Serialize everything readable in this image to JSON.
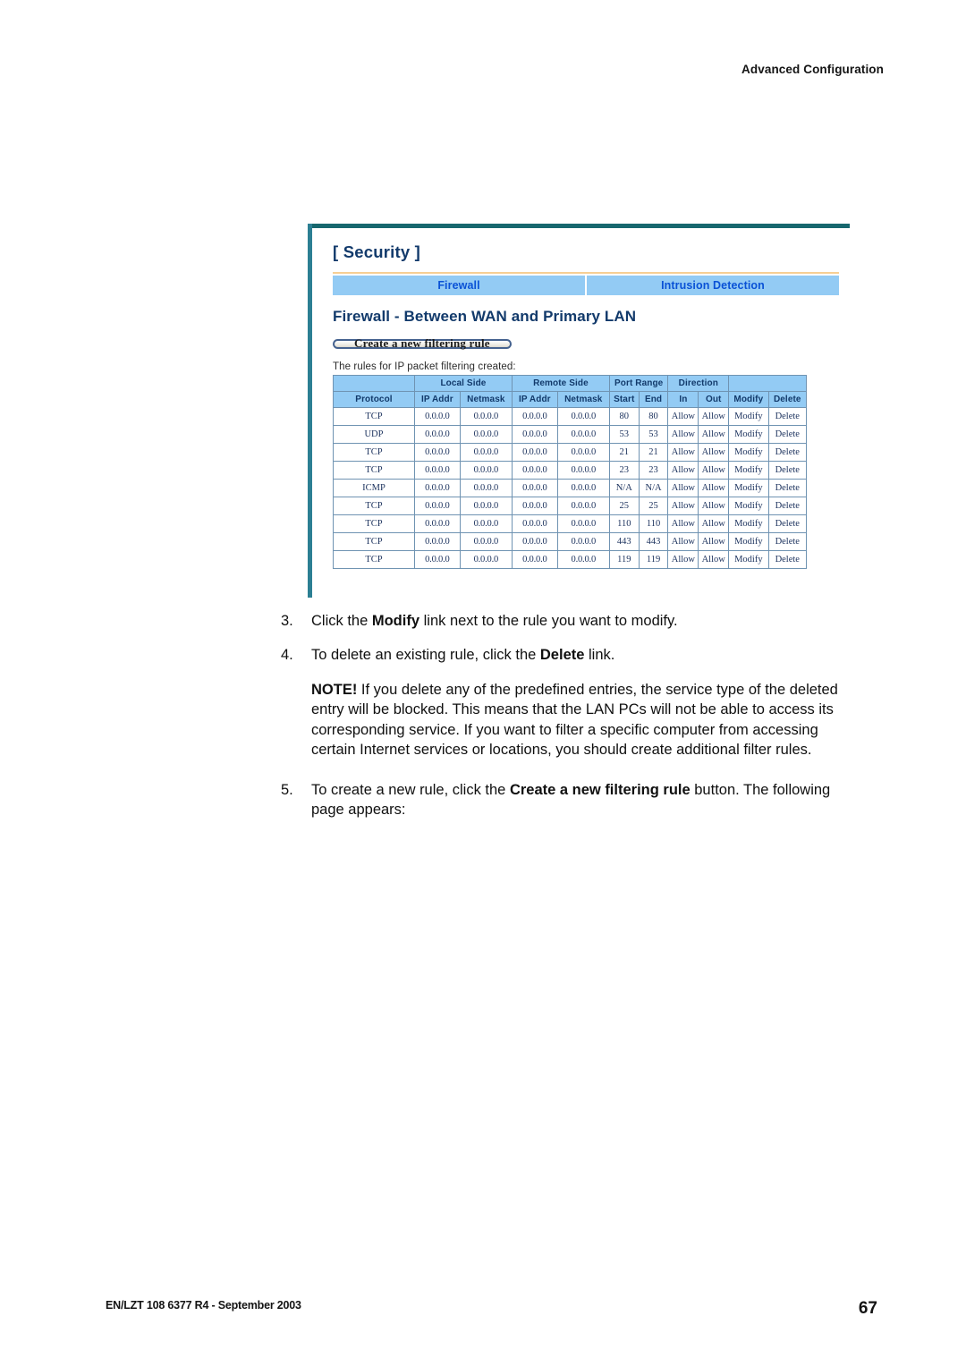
{
  "document": {
    "running_header": "Advanced Configuration",
    "footer_left": "EN/LZT 108 6377 R4 - September 2003",
    "footer_page": "67"
  },
  "screenshot": {
    "section_title": "[ Security ]",
    "tabs": [
      {
        "label": "Firewall",
        "active": true
      },
      {
        "label": "Intrusion Detection",
        "active": false
      }
    ],
    "page_heading": "Firewall - Between WAN and Primary LAN",
    "create_button": "Create a new filtering rule",
    "rules_caption": "The rules for IP packet filtering created:",
    "table": {
      "group_headers": [
        {
          "label": "",
          "span": 1
        },
        {
          "label": "Local Side",
          "span": 2
        },
        {
          "label": "Remote Side",
          "span": 2
        },
        {
          "label": "Port Range",
          "span": 2
        },
        {
          "label": "Direction",
          "span": 2
        },
        {
          "label": "",
          "span": 2
        }
      ],
      "columns": [
        "Protocol",
        "IP Addr",
        "Netmask",
        "IP Addr",
        "Netmask",
        "Start",
        "End",
        "In",
        "Out",
        "Modify",
        "Delete"
      ],
      "rows": [
        {
          "protocol": "TCP",
          "local_ip": "0.0.0.0",
          "local_mask": "0.0.0.0",
          "remote_ip": "0.0.0.0",
          "remote_mask": "0.0.0.0",
          "start": "80",
          "end": "80",
          "in": "Allow",
          "out": "Allow",
          "modify": "Modify",
          "delete": "Delete"
        },
        {
          "protocol": "UDP",
          "local_ip": "0.0.0.0",
          "local_mask": "0.0.0.0",
          "remote_ip": "0.0.0.0",
          "remote_mask": "0.0.0.0",
          "start": "53",
          "end": "53",
          "in": "Allow",
          "out": "Allow",
          "modify": "Modify",
          "delete": "Delete"
        },
        {
          "protocol": "TCP",
          "local_ip": "0.0.0.0",
          "local_mask": "0.0.0.0",
          "remote_ip": "0.0.0.0",
          "remote_mask": "0.0.0.0",
          "start": "21",
          "end": "21",
          "in": "Allow",
          "out": "Allow",
          "modify": "Modify",
          "delete": "Delete"
        },
        {
          "protocol": "TCP",
          "local_ip": "0.0.0.0",
          "local_mask": "0.0.0.0",
          "remote_ip": "0.0.0.0",
          "remote_mask": "0.0.0.0",
          "start": "23",
          "end": "23",
          "in": "Allow",
          "out": "Allow",
          "modify": "Modify",
          "delete": "Delete"
        },
        {
          "protocol": "ICMP",
          "local_ip": "0.0.0.0",
          "local_mask": "0.0.0.0",
          "remote_ip": "0.0.0.0",
          "remote_mask": "0.0.0.0",
          "start": "N/A",
          "end": "N/A",
          "in": "Allow",
          "out": "Allow",
          "modify": "Modify",
          "delete": "Delete"
        },
        {
          "protocol": "TCP",
          "local_ip": "0.0.0.0",
          "local_mask": "0.0.0.0",
          "remote_ip": "0.0.0.0",
          "remote_mask": "0.0.0.0",
          "start": "25",
          "end": "25",
          "in": "Allow",
          "out": "Allow",
          "modify": "Modify",
          "delete": "Delete"
        },
        {
          "protocol": "TCP",
          "local_ip": "0.0.0.0",
          "local_mask": "0.0.0.0",
          "remote_ip": "0.0.0.0",
          "remote_mask": "0.0.0.0",
          "start": "110",
          "end": "110",
          "in": "Allow",
          "out": "Allow",
          "modify": "Modify",
          "delete": "Delete"
        },
        {
          "protocol": "TCP",
          "local_ip": "0.0.0.0",
          "local_mask": "0.0.0.0",
          "remote_ip": "0.0.0.0",
          "remote_mask": "0.0.0.0",
          "start": "443",
          "end": "443",
          "in": "Allow",
          "out": "Allow",
          "modify": "Modify",
          "delete": "Delete"
        },
        {
          "protocol": "TCP",
          "local_ip": "0.0.0.0",
          "local_mask": "0.0.0.0",
          "remote_ip": "0.0.0.0",
          "remote_mask": "0.0.0.0",
          "start": "119",
          "end": "119",
          "in": "Allow",
          "out": "Allow",
          "modify": "Modify",
          "delete": "Delete"
        }
      ]
    }
  },
  "steps": [
    {
      "number": "3.",
      "parts": [
        {
          "text": "Click the ",
          "bold": false
        },
        {
          "text": "Modify",
          "bold": true
        },
        {
          "text": " link next to the rule you want to modify.",
          "bold": false
        }
      ]
    },
    {
      "number": "4.",
      "parts": [
        {
          "text": "To delete an existing rule, click the ",
          "bold": false
        },
        {
          "text": "Delete",
          "bold": true
        },
        {
          "text": " link.",
          "bold": false
        }
      ]
    }
  ],
  "note": {
    "parts": [
      {
        "text": "NOTE!",
        "bold": true
      },
      {
        "text": " If you delete any of the predefined entries, the service type of the deleted entry will be blocked. This means that the LAN PCs will not be able to access its corresponding service. If you want to filter a specific computer from accessing certain Internet services or locations, you should create additional filter rules.",
        "bold": false
      }
    ]
  },
  "steps_after_note": [
    {
      "number": "5.",
      "parts": [
        {
          "text": "To create a new rule, click the ",
          "bold": false
        },
        {
          "text": "Create a new filtering rule",
          "bold": true
        },
        {
          "text": " button. The following page appears:",
          "bold": false
        }
      ]
    }
  ],
  "colors": {
    "tab_background": "#93cbf4",
    "tab_text": "#0a52d6",
    "heading_text": "#123a6b",
    "frame_top": "#17676e",
    "frame_left": "#2c7f93",
    "orange_rule": "#f7cf94",
    "table_border": "#6f93b2",
    "link_text": "#6b3fb0"
  }
}
